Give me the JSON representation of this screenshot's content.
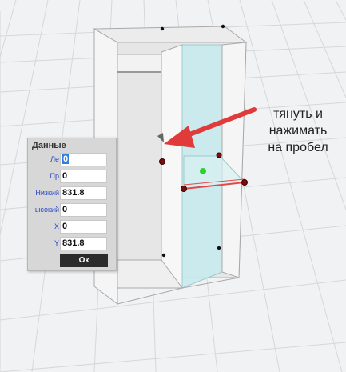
{
  "data_panel": {
    "title": "Данные",
    "rows": [
      {
        "label": "Ле",
        "value": "0",
        "selected": true
      },
      {
        "label": "Пр",
        "value": "0",
        "selected": false
      },
      {
        "label": "Низкий",
        "value": "831.8",
        "selected": false
      },
      {
        "label": "ысокий",
        "value": "0",
        "selected": false
      },
      {
        "label": "X",
        "value": "0",
        "selected": false
      },
      {
        "label": "Y",
        "value": "831.8",
        "selected": false
      }
    ],
    "ok_label": "Ок"
  },
  "annotation": {
    "lines": [
      "тянуть и",
      "нажимать",
      "на пробел"
    ]
  },
  "colors": {
    "arrow": "#e03a3a",
    "shelf_line": "#e24848",
    "handle_center": "#2fd12f",
    "glass": "#bfe7ea"
  }
}
